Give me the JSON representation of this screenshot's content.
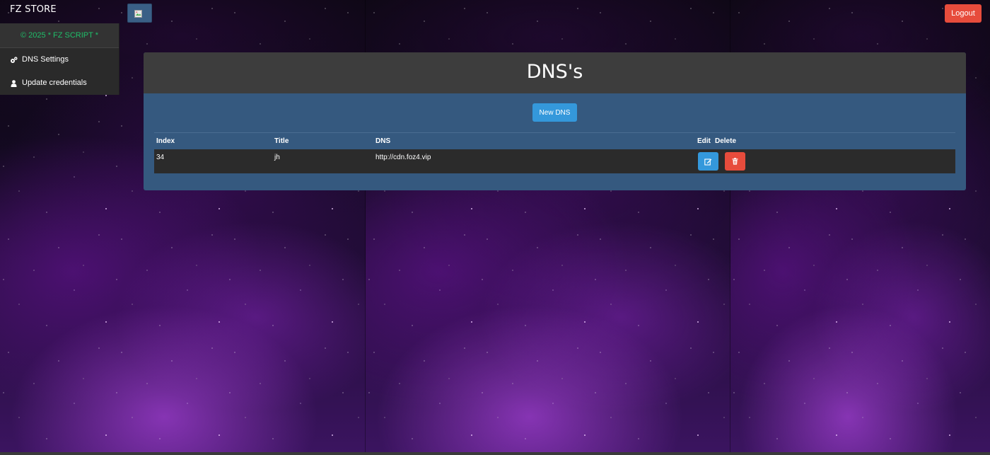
{
  "brand": {
    "title": "FZ STORE"
  },
  "sidebar": {
    "footer": "© 2025 * FZ SCRIPT *",
    "items": [
      {
        "label": "DNS Settings",
        "icon": "gears-icon"
      },
      {
        "label": "Update credentials",
        "icon": "user-icon"
      }
    ]
  },
  "header": {
    "toggle_icon": "broken-image-icon",
    "logout_label": "Logout"
  },
  "panel": {
    "title": "DNS's",
    "new_button_label": "New DNS",
    "columns": {
      "index": "Index",
      "title": "Title",
      "dns": "DNS",
      "edit": "Edit",
      "delete": "Delete"
    },
    "rows": [
      {
        "index": "34",
        "title": "jh",
        "dns": "http://cdn.foz4.vip"
      }
    ]
  },
  "colors": {
    "panel_bg": "#35597f",
    "panel_header_bg": "#3d3d3d",
    "primary": "#3498db",
    "danger": "#e74c3c",
    "footer_text": "#1fbf6a"
  }
}
